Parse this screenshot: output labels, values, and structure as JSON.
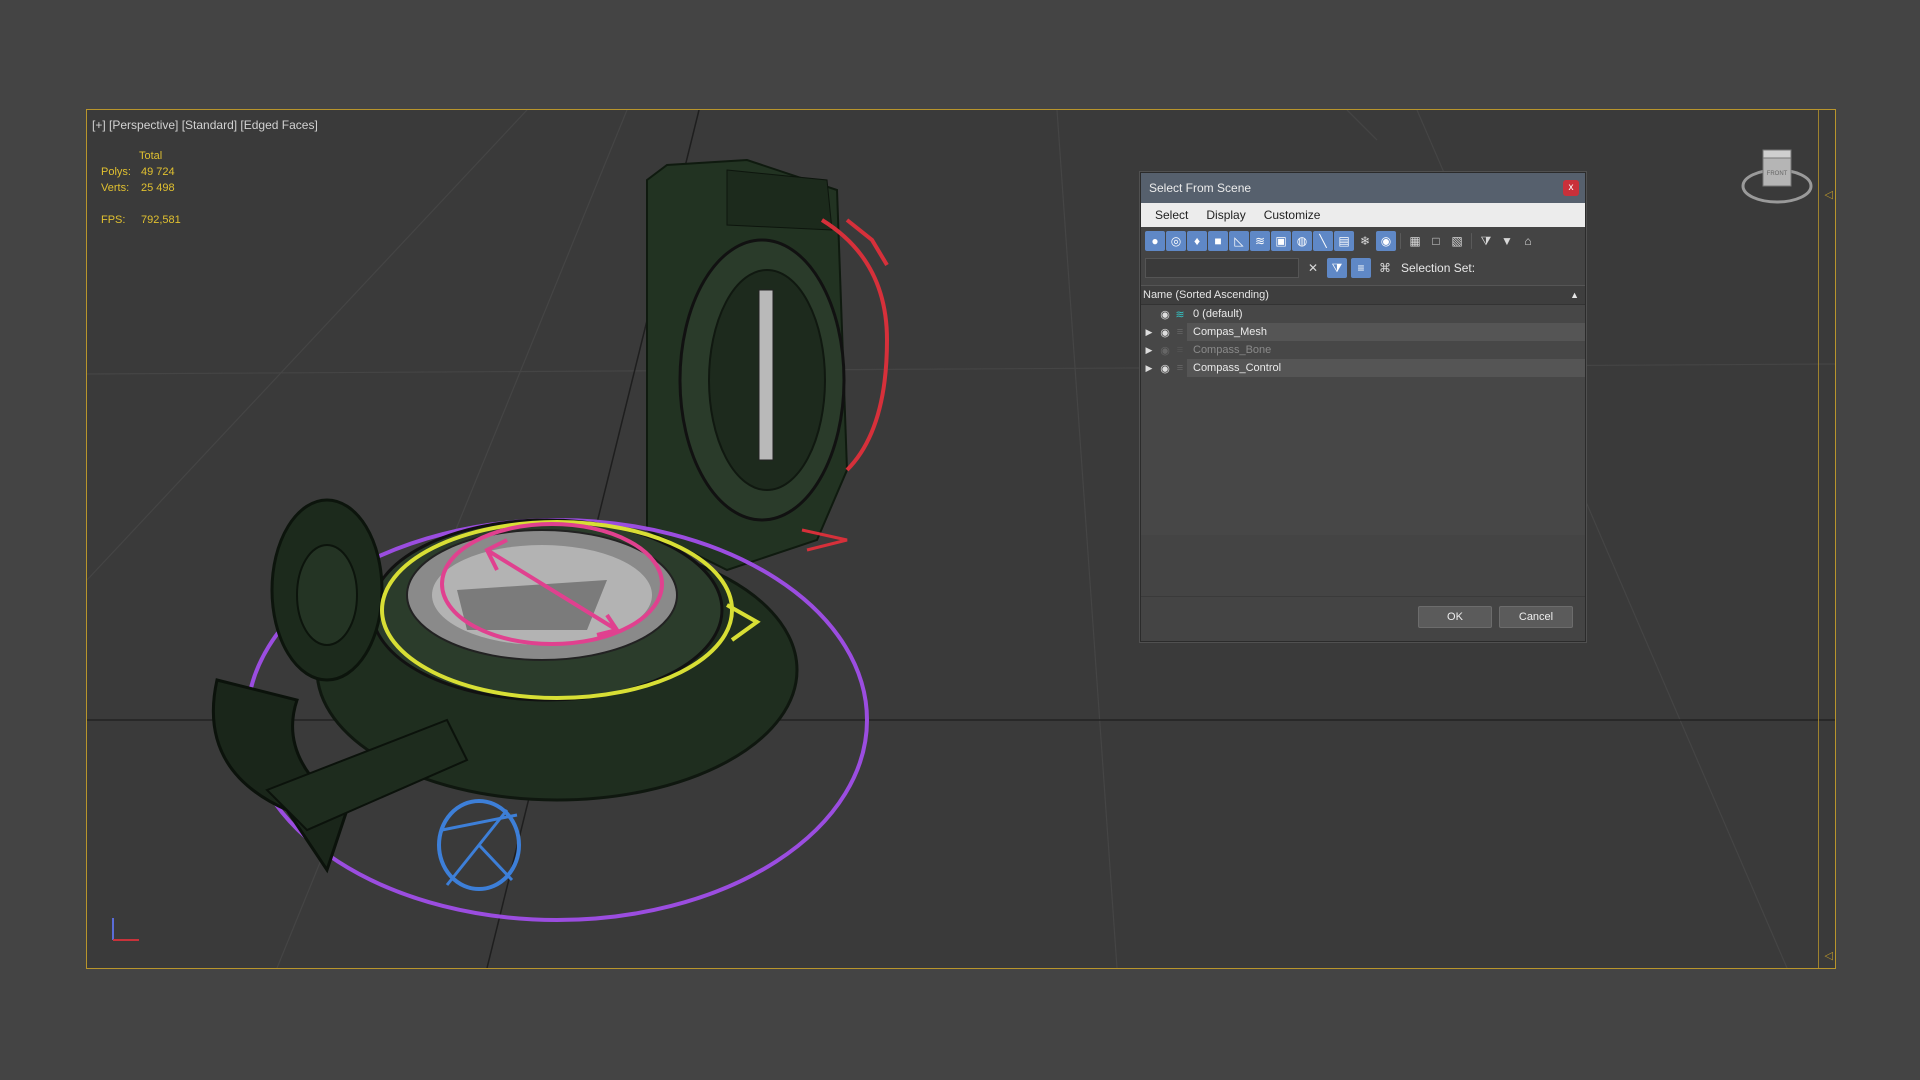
{
  "viewport": {
    "label": "[+] [Perspective] [Standard] [Edged Faces]",
    "stats": {
      "header": "Total",
      "polys_label": "Polys:",
      "polys_value": "49 724",
      "verts_label": "Verts:",
      "verts_value": "25 498",
      "fps_label": "FPS:",
      "fps_value": "792,581"
    },
    "viewcube_face": "FRONT"
  },
  "dialog": {
    "title": "Select From Scene",
    "close": "x",
    "menu": [
      "Select",
      "Display",
      "Customize"
    ],
    "toolbar_icons": [
      "geometry-icon",
      "shapes-icon",
      "lights-icon",
      "cameras-icon",
      "helpers-icon",
      "space-warps-icon",
      "groups-icon",
      "xrefs-icon",
      "bones-icon",
      "containers-icon",
      "frozen-icon",
      "hidden-icon",
      "display-all-icon",
      "display-none-icon",
      "invert-icon",
      "filter-icon",
      "filter-options-icon",
      "layer-icon"
    ],
    "search_placeholder": "",
    "selection_set_label": "Selection Set:",
    "list_header": "Name (Sorted Ascending)",
    "items": [
      {
        "name": "0 (default)",
        "expandable": false,
        "visible": true
      },
      {
        "name": "Compas_Mesh",
        "expandable": true,
        "visible": true
      },
      {
        "name": "Compass_Bone",
        "expandable": true,
        "visible": false
      },
      {
        "name": "Compass_Control",
        "expandable": true,
        "visible": true
      }
    ],
    "ok_label": "OK",
    "cancel_label": "Cancel"
  },
  "colors": {
    "accent": "#5f88c6",
    "viewport_border": "#b8952c",
    "stats_text": "#e0c030"
  }
}
